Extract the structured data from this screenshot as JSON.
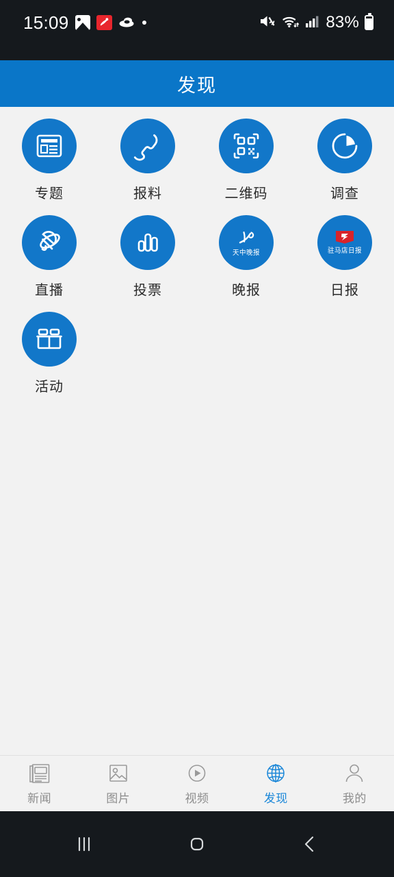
{
  "status_bar": {
    "time": "15:09",
    "battery_percent": "83%",
    "left_icons": [
      "gallery-icon",
      "red-app-icon",
      "cloud-icon",
      "dot-indicator"
    ],
    "right_icons": [
      "mute-icon",
      "wifi-icon",
      "signal-icon",
      "battery-icon"
    ],
    "background_color": "#15191d"
  },
  "header": {
    "title": "发现",
    "background_color": "#0a76c8",
    "text_color": "#ffffff"
  },
  "grid": {
    "accent_color": "#1277c9",
    "items": [
      {
        "label": "专题",
        "icon": "newspaper-icon"
      },
      {
        "label": "报料",
        "icon": "phone-handset-icon"
      },
      {
        "label": "二维码",
        "icon": "qr-code-icon"
      },
      {
        "label": "调查",
        "icon": "pie-chart-icon"
      },
      {
        "label": "直播",
        "icon": "satellite-dish-icon"
      },
      {
        "label": "投票",
        "icon": "bar-chart-icon"
      },
      {
        "label": "晚报",
        "icon": "tianzhong-evening-news-logo",
        "logo_text": "天中晚报"
      },
      {
        "label": "日报",
        "icon": "zhumadian-daily-logo",
        "logo_text": "驻马店日报"
      },
      {
        "label": "活动",
        "icon": "gift-box-icon"
      }
    ]
  },
  "tabbar": {
    "active_color": "#1b87d8",
    "inactive_color": "#8d8d8d",
    "tabs": [
      {
        "label": "新闻",
        "icon": "newspaper-tab-icon",
        "active": false
      },
      {
        "label": "图片",
        "icon": "image-tab-icon",
        "active": false
      },
      {
        "label": "视频",
        "icon": "play-circle-tab-icon",
        "active": false
      },
      {
        "label": "发现",
        "icon": "globe-tab-icon",
        "active": true
      },
      {
        "label": "我的",
        "icon": "person-tab-icon",
        "active": false
      }
    ]
  },
  "navbar": {
    "buttons": [
      {
        "name": "recents",
        "icon": "recents-bars-icon"
      },
      {
        "name": "home",
        "icon": "home-square-icon"
      },
      {
        "name": "back",
        "icon": "back-chevron-icon"
      }
    ]
  }
}
